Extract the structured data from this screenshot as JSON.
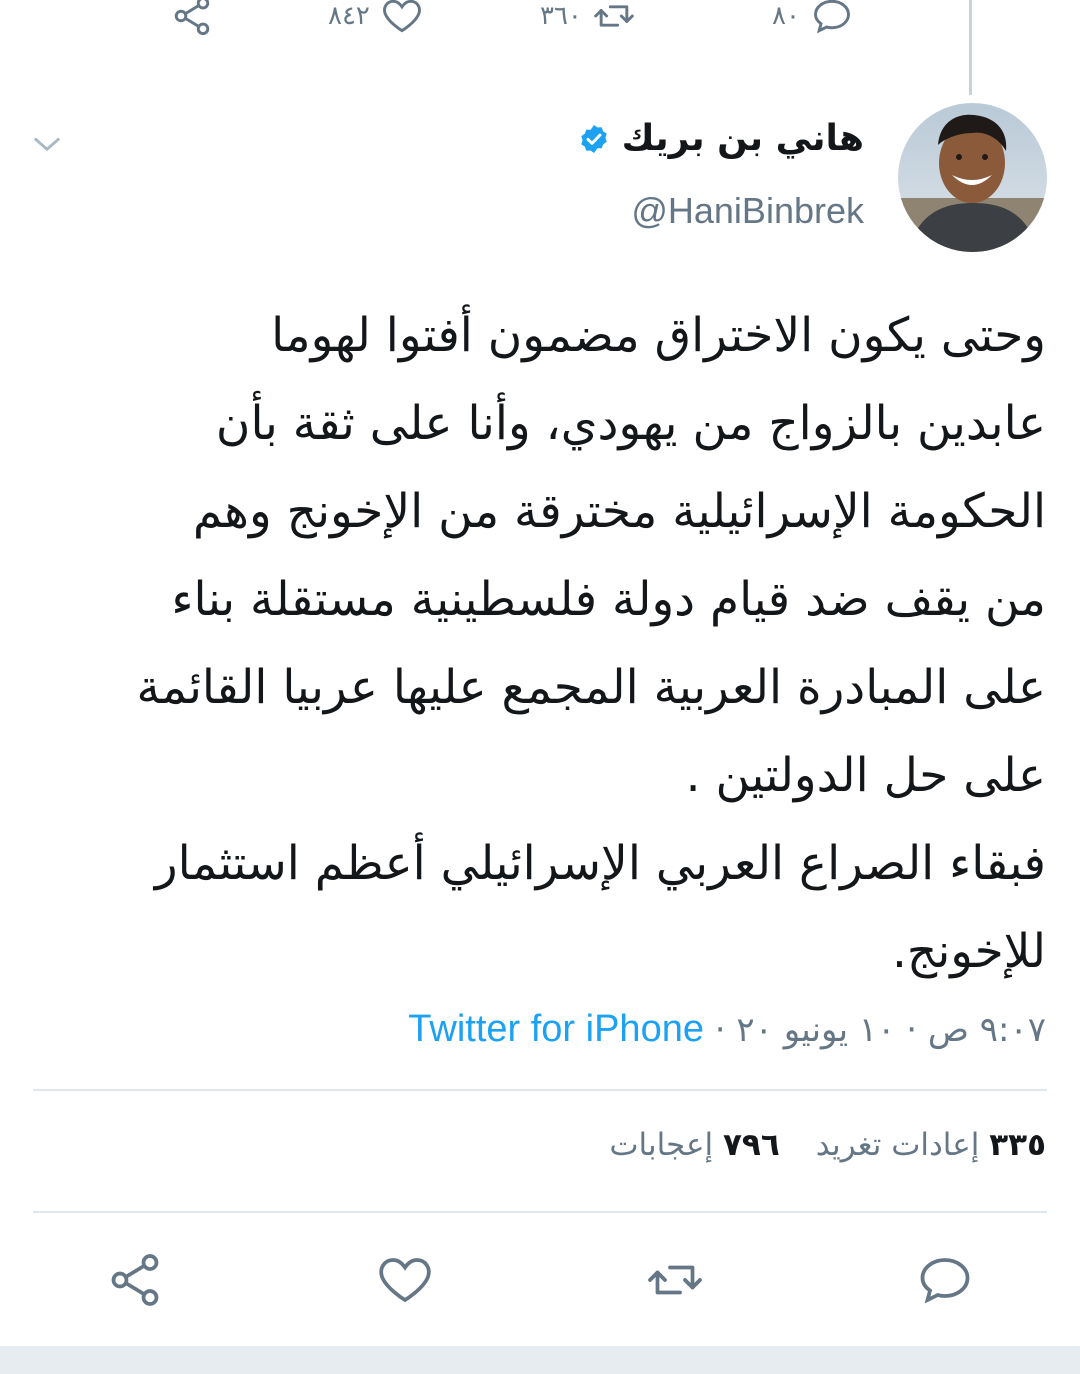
{
  "top_actions": {
    "share_icon": "share-icon",
    "like_count": "٨٤٢",
    "retweet_count": "٣٦٠",
    "reply_count": "٨٠"
  },
  "author": {
    "display_name": "هاني بن بريك",
    "handle": "@HaniBinbrek",
    "verified": true
  },
  "tweet": {
    "lines": [
      "وحتى يكون الاختراق مضمون أفتوا لهوما",
      "عابدين بالزواج من يهودي، وأنا على ثقة بأن",
      "الحكومة الإسرائيلية مخترقة من الإخونج وهم",
      "من يقف ضد قيام دولة فلسطينية مستقلة بناء",
      "على المبادرة العربية المجمع عليها عربيا القائمة",
      "على حل الدولتين .",
      "فبقاء الصراع العربي الإسرائيلي أعظم استثمار",
      "للإخونج."
    ],
    "timestamp": "٩:٠٧ ص · ١٠ يونيو ٢٠",
    "separator": " · ",
    "source": "Twitter for iPhone"
  },
  "stats": {
    "retweets_count": "٣٣٥",
    "retweets_label": "إعادات تغريد",
    "likes_count": "٧٩٦",
    "likes_label": "إعجابات"
  },
  "colors": {
    "accent": "#1da1f2",
    "muted": "#657786",
    "divider": "#e1e8ed"
  }
}
